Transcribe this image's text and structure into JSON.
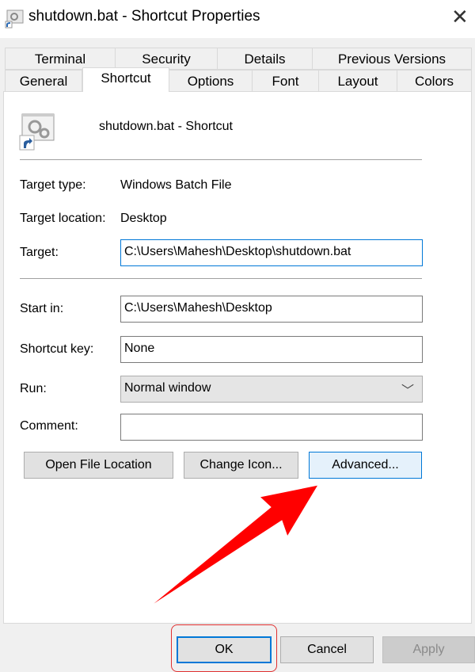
{
  "window": {
    "title": "shutdown.bat - Shortcut Properties"
  },
  "tabs_row1": [
    "Terminal",
    "Security",
    "Details",
    "Previous Versions"
  ],
  "tabs_row2": [
    "General",
    "Shortcut",
    "Options",
    "Font",
    "Layout",
    "Colors"
  ],
  "selected_tab": "Shortcut",
  "header": {
    "name": "shutdown.bat - Shortcut"
  },
  "fields": {
    "target_type": {
      "label": "Target type:",
      "value": "Windows Batch File"
    },
    "target_location": {
      "label": "Target location:",
      "value": "Desktop"
    },
    "target": {
      "label": "Target:",
      "value": "C:\\Users\\Mahesh\\Desktop\\shutdown.bat"
    },
    "start_in": {
      "label": "Start in:",
      "value": "C:\\Users\\Mahesh\\Desktop"
    },
    "shortcut_key": {
      "label": "Shortcut key:",
      "value": "None"
    },
    "run": {
      "label": "Run:",
      "value": "Normal window"
    },
    "comment": {
      "label": "Comment:",
      "value": ""
    }
  },
  "buttons": {
    "open_location": "Open File Location",
    "change_icon": "Change Icon...",
    "advanced": "Advanced...",
    "ok": "OK",
    "cancel": "Cancel",
    "apply": "Apply"
  },
  "annotation": {
    "arrow_color": "#ff0000",
    "highlight_color": "#e03030"
  }
}
